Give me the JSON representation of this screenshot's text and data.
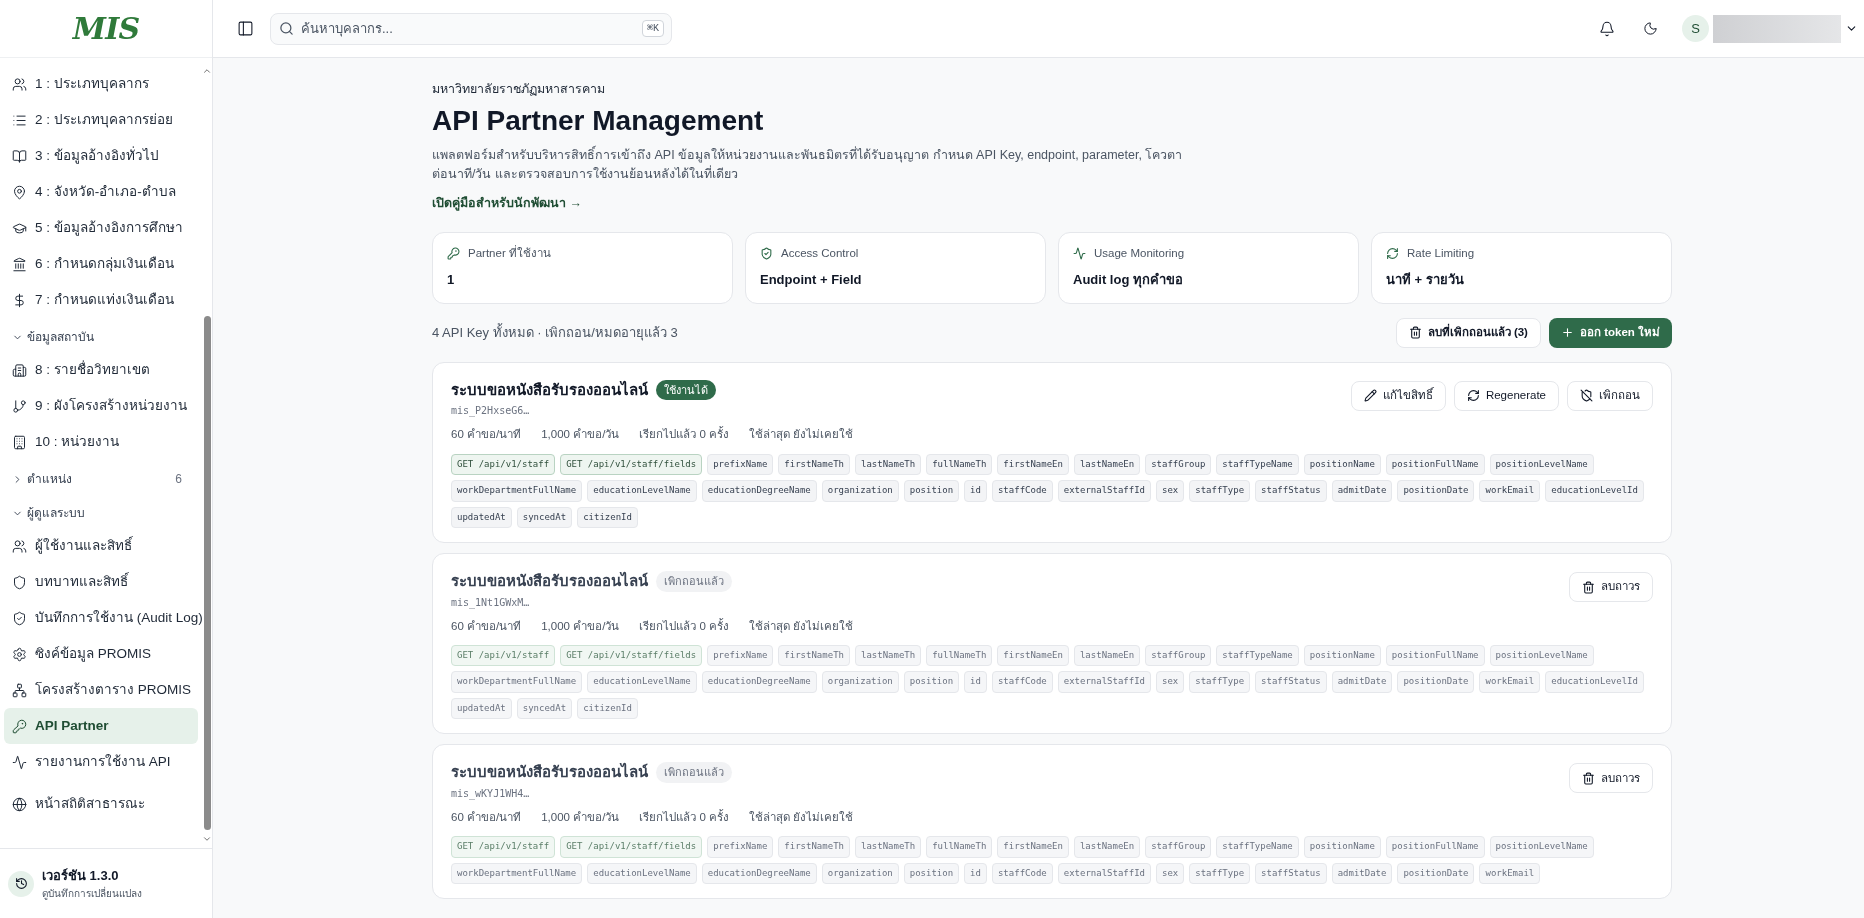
{
  "sidebar": {
    "logo": "MIS",
    "groups": [
      {
        "items": [
          {
            "label": "1 : ประเภทบุคลากร",
            "selected": false
          },
          {
            "label": "2 : ประเภทบุคลากรย่อย",
            "selected": false
          },
          {
            "label": "3 : ข้อมูลอ้างอิงทั่วไป",
            "selected": false
          },
          {
            "label": "4 : จังหวัด-อำเภอ-ตำบล",
            "selected": false
          },
          {
            "label": "5 : ข้อมูลอ้างอิงการศึกษา",
            "selected": false
          },
          {
            "label": "6 : กำหนดกลุ่มเงินเดือน",
            "selected": false
          },
          {
            "label": "7 : กำหนดแท่งเงินเดือน",
            "selected": false
          }
        ]
      },
      {
        "label": "ข้อมูลสถาบัน",
        "expanded": true,
        "items": [
          {
            "label": "8 : รายชื่อวิทยาเขต",
            "selected": false
          },
          {
            "label": "9 : ผังโครงสร้างหน่วยงาน",
            "selected": false
          },
          {
            "label": "10 : หน่วยงาน",
            "selected": false
          }
        ]
      },
      {
        "label": "ตำแหน่ง",
        "expanded": false,
        "count": "6"
      },
      {
        "label": "ผู้ดูแลระบบ",
        "expanded": true,
        "items": [
          {
            "label": "ผู้ใช้งานและสิทธิ์",
            "selected": false
          },
          {
            "label": "บทบาทและสิทธิ์",
            "selected": false
          },
          {
            "label": "บันทึกการใช้งาน (Audit Log)",
            "selected": false
          },
          {
            "label": "ซิงค์ข้อมูล PROMIS",
            "selected": false
          },
          {
            "label": "โครงสร้างตาราง PROMIS",
            "selected": false
          },
          {
            "label": "API Partner",
            "selected": true
          },
          {
            "label": "รายงานการใช้งาน API",
            "selected": false
          }
        ]
      },
      {
        "items": [
          {
            "label": "หน้าสถิติสาธารณะ",
            "selected": false
          }
        ]
      }
    ],
    "version": {
      "title": "เวอร์ชัน 1.3.0",
      "subtitle": "ดูบันทึกการเปลี่ยนแปลง"
    }
  },
  "topbar": {
    "search": {
      "placeholder": "ค้นหาบุคลากร...",
      "shortcut": "⌘K"
    },
    "avatar": "S"
  },
  "header": {
    "org": "มหาวิทยาลัยราชภัฏมหาสารคาม",
    "title": "API Partner Management",
    "description": "แพลตฟอร์มสำหรับบริหารสิทธิ์การเข้าถึง API ข้อมูลให้หน่วยงานและพันธมิตรที่ได้รับอนุญาต กำหนด API Key, endpoint, parameter, โควตาต่อนาที/วัน และตรวจสอบการใช้งานย้อนหลังได้ในที่เดียว",
    "link": "เปิดคู่มือสำหรับนักพัฒนา →"
  },
  "stats": [
    {
      "label": "Partner ที่ใช้งาน",
      "value": "1"
    },
    {
      "label": "Access Control",
      "value": "Endpoint + Field"
    },
    {
      "label": "Usage Monitoring",
      "value": "Audit log ทุกคำขอ"
    },
    {
      "label": "Rate Limiting",
      "value": "นาที + รายวัน"
    }
  ],
  "summary": "4 API Key ทั้งหมด · เพิกถอน/หมดอายุแล้ว 3",
  "toolbar": [
    {
      "kind": "outline",
      "label": "ลบที่เพิกถอนแล้ว (3)"
    },
    {
      "kind": "primary",
      "label": "ออก token ใหม่"
    }
  ],
  "keys": [
    {
      "name": "ระบบขอหนังสือรับรองออนไลน์",
      "status": {
        "kind": "active",
        "label": "ใช้งานได้"
      },
      "key": "mis_P2HxseG6…",
      "meta": [
        "60 คำขอ/นาที",
        "1,000 คำขอ/วัน",
        "เรียกไปแล้ว 0 ครั้ง",
        "ใช้ล่าสุด ยังไม่เคยใช้"
      ],
      "actions": [
        {
          "kind": "edit",
          "label": "แก้ไขสิทธิ์"
        },
        {
          "kind": "regenerate",
          "label": "Regenerate"
        },
        {
          "kind": "revoke",
          "label": "เพิกถอน"
        }
      ],
      "endpoints": [
        "GET /api/v1/staff",
        "GET /api/v1/staff/fields"
      ],
      "fields": [
        "prefixName",
        "firstNameTh",
        "lastNameTh",
        "fullNameTh",
        "firstNameEn",
        "lastNameEn",
        "staffGroup",
        "staffTypeName",
        "positionName",
        "positionFullName",
        "positionLevelName",
        "workDepartmentFullName",
        "educationLevelName",
        "educationDegreeName",
        "organization",
        "position",
        "id",
        "staffCode",
        "externalStaffId",
        "sex",
        "staffType",
        "staffStatus",
        "admitDate",
        "positionDate",
        "workEmail",
        "educationLevelId",
        "updatedAt",
        "syncedAt",
        "citizenId"
      ]
    },
    {
      "name": "ระบบขอหนังสือรับรองออนไลน์",
      "status": {
        "kind": "revoked",
        "label": "เพิกถอนแล้ว"
      },
      "key": "mis_1Nt1GWxM…",
      "meta": [
        "60 คำขอ/นาที",
        "1,000 คำขอ/วัน",
        "เรียกไปแล้ว 0 ครั้ง",
        "ใช้ล่าสุด ยังไม่เคยใช้"
      ],
      "actions": [
        {
          "kind": "delete",
          "label": "ลบถาวร"
        }
      ],
      "endpoints": [
        "GET /api/v1/staff",
        "GET /api/v1/staff/fields"
      ],
      "fields": [
        "prefixName",
        "firstNameTh",
        "lastNameTh",
        "fullNameTh",
        "firstNameEn",
        "lastNameEn",
        "staffGroup",
        "staffTypeName",
        "positionName",
        "positionFullName",
        "positionLevelName",
        "workDepartmentFullName",
        "educationLevelName",
        "educationDegreeName",
        "organization",
        "position",
        "id",
        "staffCode",
        "externalStaffId",
        "sex",
        "staffType",
        "staffStatus",
        "admitDate",
        "positionDate",
        "workEmail",
        "educationLevelId",
        "updatedAt",
        "syncedAt",
        "citizenId"
      ]
    },
    {
      "name": "ระบบขอหนังสือรับรองออนไลน์",
      "status": {
        "kind": "revoked",
        "label": "เพิกถอนแล้ว"
      },
      "key": "mis_wKYJ1WH4…",
      "meta": [
        "60 คำขอ/นาที",
        "1,000 คำขอ/วัน",
        "เรียกไปแล้ว 0 ครั้ง",
        "ใช้ล่าสุด ยังไม่เคยใช้"
      ],
      "actions": [
        {
          "kind": "delete",
          "label": "ลบถาวร"
        }
      ],
      "endpoints": [
        "GET /api/v1/staff",
        "GET /api/v1/staff/fields"
      ],
      "fields": [
        "prefixName",
        "firstNameTh",
        "lastNameTh",
        "fullNameTh",
        "firstNameEn",
        "lastNameEn",
        "staffGroup",
        "staffTypeName",
        "positionName",
        "positionFullName",
        "positionLevelName",
        "workDepartmentFullName",
        "educationLevelName",
        "educationDegreeName",
        "organization",
        "position",
        "id",
        "staffCode",
        "externalStaffId",
        "sex",
        "staffType",
        "staffStatus",
        "admitDate",
        "positionDate",
        "workEmail"
      ]
    }
  ]
}
